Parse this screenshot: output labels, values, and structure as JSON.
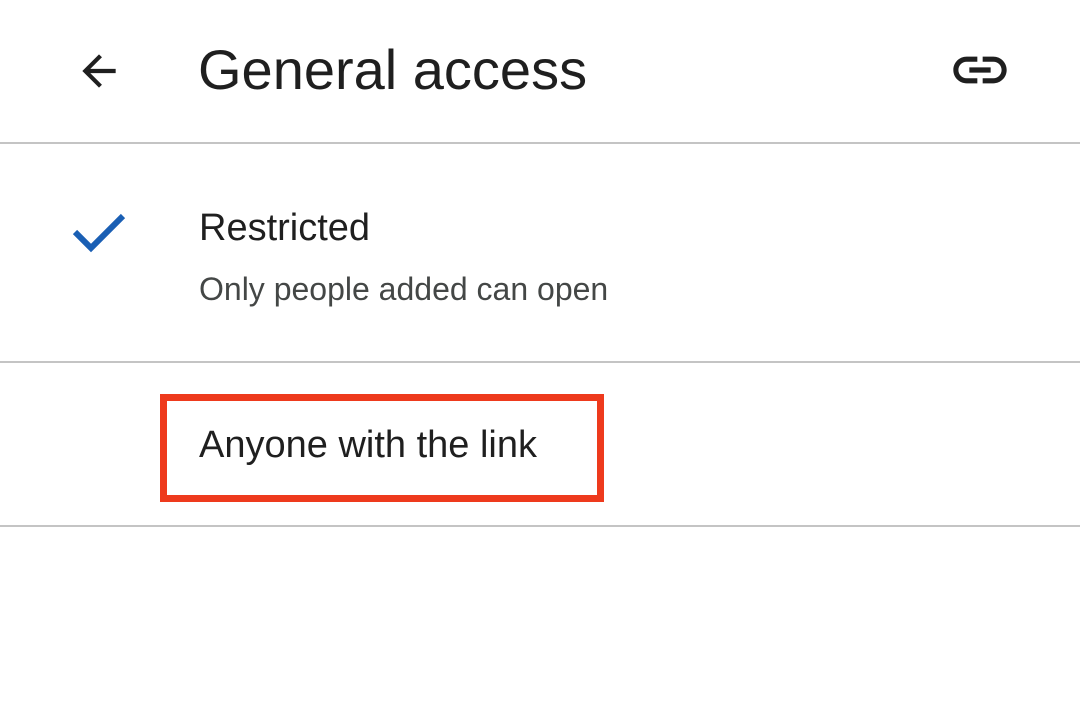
{
  "header": {
    "title": "General access",
    "back_icon": "arrow-back-icon",
    "link_icon": "link-icon"
  },
  "options": [
    {
      "title": "Restricted",
      "subtitle": "Only people added can open",
      "selected": true,
      "icon": "checkmark-icon"
    },
    {
      "title": "Anyone with the link",
      "selected": false,
      "highlighted": true
    }
  ],
  "colors": {
    "check": "#1a5fb4",
    "highlight": "#ee3a1d",
    "divider": "#c4c4c4",
    "text": "#1f1f1f",
    "subtext": "#444746"
  }
}
